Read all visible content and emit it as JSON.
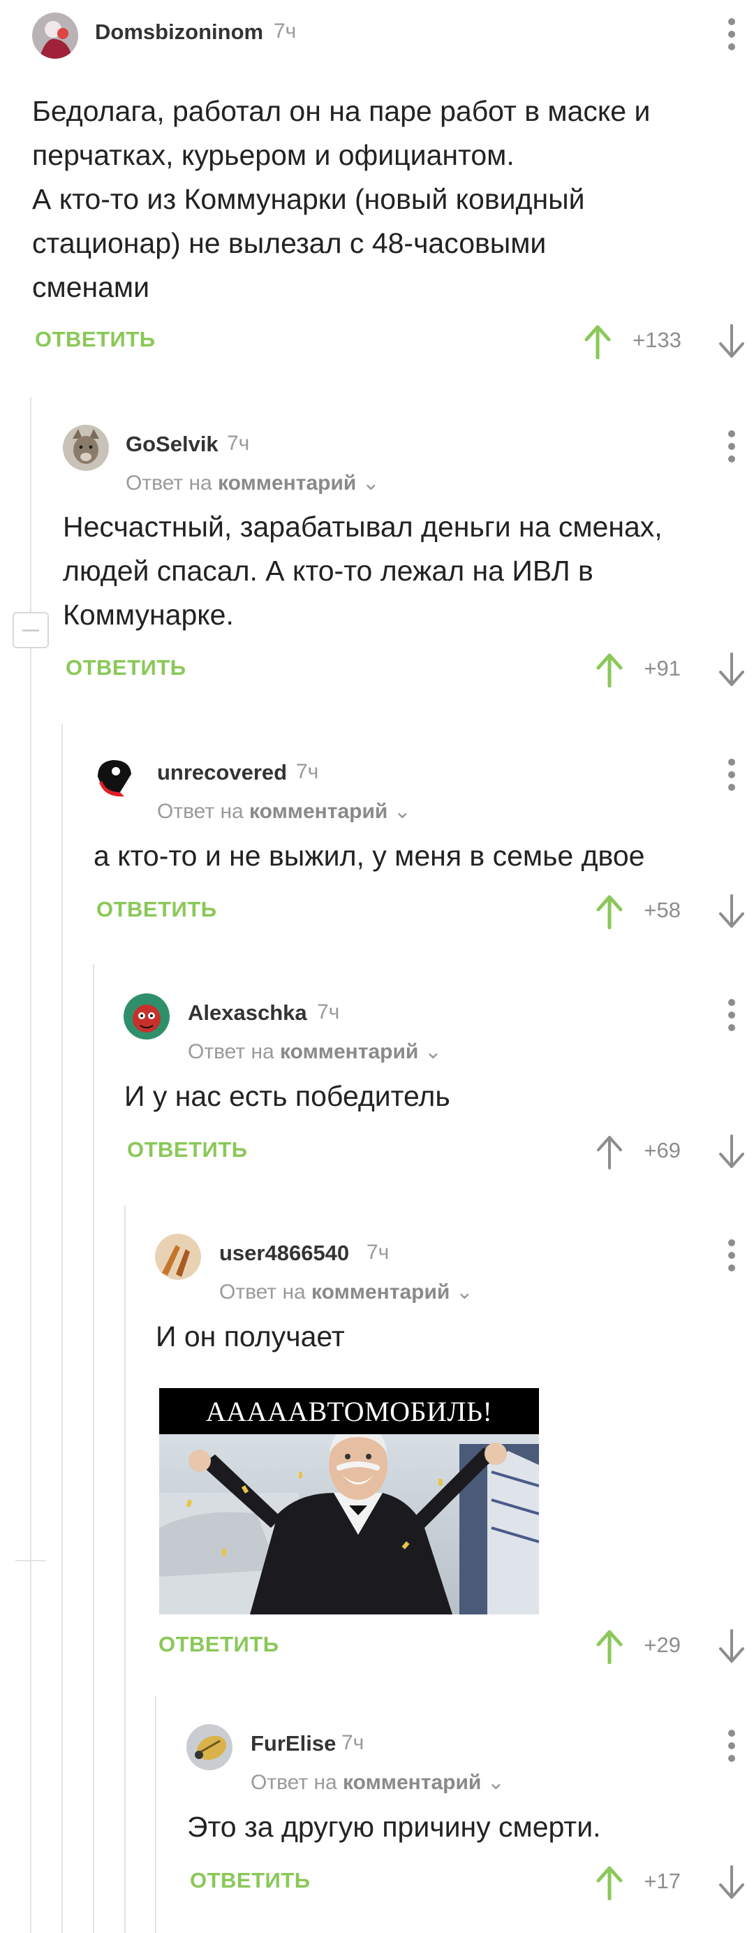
{
  "comments": [
    {
      "user": "Domsbizoninom",
      "time": "7ч",
      "text_lines": [
        "Бедолага, работал он на паре работ в маске и",
        "перчатках, курьером и официантом.",
        "А кто-то из Коммунарки (новый ковидный",
        "стационар) не вылезал с 48-часовыми",
        "сменами"
      ],
      "reply_label": "ОТВЕТИТЬ",
      "score": "+133"
    },
    {
      "user": "GoSelvik",
      "time": "7ч",
      "reply_to_prefix": "Ответ на",
      "reply_to_target": "комментарий",
      "text_lines": [
        "Несчастный, зарабатывал деньги на сменах,",
        "людей спасал. А кто-то лежал на ИВЛ в",
        "Коммунарке."
      ],
      "reply_label": "ОТВЕТИТЬ",
      "score": "+91"
    },
    {
      "user": "unrecovered",
      "time": "7ч",
      "reply_to_prefix": "Ответ на",
      "reply_to_target": "комментарий",
      "text_lines": [
        "а кто-то и не выжил, у меня в семье двое"
      ],
      "reply_label": "ОТВЕТИТЬ",
      "score": "+58"
    },
    {
      "user": "Alexaschka",
      "time": "7ч",
      "reply_to_prefix": "Ответ на",
      "reply_to_target": "комментарий",
      "text_lines": [
        "И у нас есть победитель"
      ],
      "reply_label": "ОТВЕТИТЬ",
      "score": "+69"
    },
    {
      "user": "user4866540",
      "time": "7ч",
      "reply_to_prefix": "Ответ на",
      "reply_to_target": "комментарий",
      "text_lines": [
        "И он получает"
      ],
      "image_caption": "АААААВТОМОБИЛЬ!",
      "reply_label": "ОТВЕТИТЬ",
      "score": "+29"
    },
    {
      "user": "FurElise",
      "time": "7ч",
      "reply_to_prefix": "Ответ на",
      "reply_to_target": "комментарий",
      "text_lines": [
        "Это за другую причину смерти."
      ],
      "reply_label": "ОТВЕТИТЬ",
      "score": "+17"
    }
  ],
  "colors": {
    "accent_green": "#8ac858",
    "muted_gray": "#8d8d8d",
    "thread_line": "#e3e3e3"
  }
}
